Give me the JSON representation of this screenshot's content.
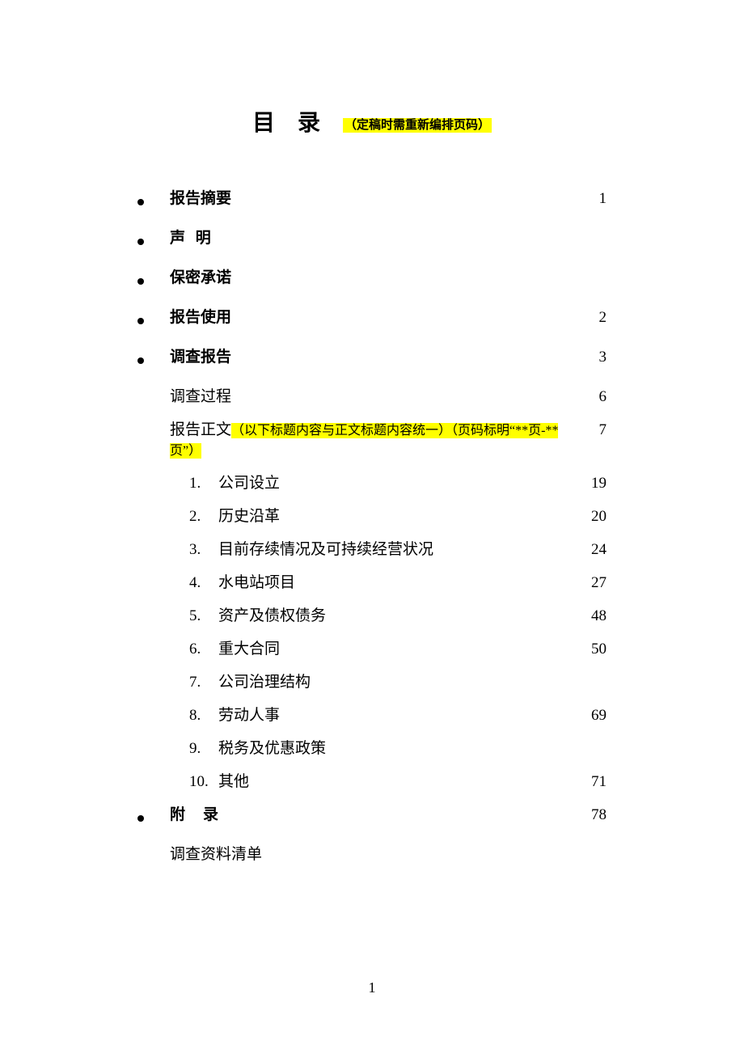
{
  "title": {
    "main": "目录",
    "note": "（定稿时需重新编排页码）"
  },
  "toc": [
    {
      "bullet": true,
      "label": "报告摘要",
      "bold": true,
      "page": "1"
    },
    {
      "bullet": true,
      "label": "声 明",
      "bold": true,
      "page": ""
    },
    {
      "bullet": true,
      "label": "保密承诺",
      "bold": true,
      "page": ""
    },
    {
      "bullet": true,
      "label": "报告使用",
      "bold": true,
      "page": "2"
    },
    {
      "bullet": true,
      "label": "调查报告",
      "bold": true,
      "page": "3"
    }
  ],
  "sub": {
    "process": {
      "label": "调查过程",
      "page": "6"
    },
    "body": {
      "label": "报告正文",
      "note": "（以下标题内容与正文标题内容统一）（页码标明“**页-**页”）",
      "page": "7"
    }
  },
  "numbered": [
    {
      "num": "1.",
      "label": "公司设立",
      "page": "19"
    },
    {
      "num": "2.",
      "label": "历史沿革",
      "page": "20"
    },
    {
      "num": "3.",
      "label": "目前存续情况及可持续经营状况",
      "page": "24"
    },
    {
      "num": "4.",
      "label": "水电站项目",
      "page": "27"
    },
    {
      "num": "5.",
      "label": "资产及债权债务",
      "page": "48"
    },
    {
      "num": "6.",
      "label": "重大合同",
      "page": "50"
    },
    {
      "num": "7.",
      "label": "公司治理结构",
      "page": ""
    },
    {
      "num": "8.",
      "label": "劳动人事",
      "page": "69"
    },
    {
      "num": "9.",
      "label": "税务及优惠政策",
      "page": ""
    },
    {
      "num": "10.",
      "label": "其他",
      "page": "71"
    }
  ],
  "appendix": {
    "label": "附录",
    "page": "78",
    "sub": "调查资料清单"
  },
  "footer": "1"
}
